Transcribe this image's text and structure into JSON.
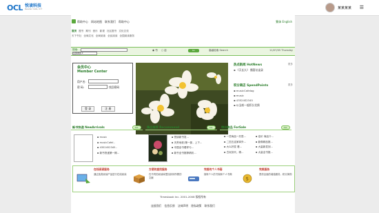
{
  "app": {
    "logo_mark": "OCL",
    "logo_cn": "悦读科技",
    "logo_en": "Reader Cafe, ICT",
    "user_name": "某某某某",
    "menu_icon": "☰"
  },
  "nav": {
    "links": [
      "帮助中心",
      "网站地图",
      "联系我们",
      "帮助中心"
    ],
    "lang": "繁体 English"
  },
  "subnav": {
    "row1": [
      "首页",
      "图书",
      "期刊",
      "音乐",
      "影视",
      "社区图书",
      "文化交流"
    ],
    "row2": [
      "天下书社",
      "全局文化",
      "全局阅读",
      "全民阅读",
      "全国阅读服务"
    ]
  },
  "search": {
    "label": "搜索:",
    "select": "全部类别 ▾",
    "radio1": "书",
    "radio2": "店",
    "button": "Go",
    "advanced": "高级检索 Search",
    "date": "11/07/05 Thursday"
  },
  "member": {
    "title": "会员中心",
    "title_en": "Member Center",
    "user_label": "用户名:",
    "pass_label": "密 码:",
    "forgot": "找回密码",
    "login": "登 录",
    "register": "注 册"
  },
  "hot": {
    "title": "热点新闻 HotNews",
    "more": "更多",
    "items": [
      "《天长久》",
      "播客访谈录"
    ]
  },
  "spend": {
    "title": "积分商店 SpendPoints",
    "more": "更多",
    "items": [
      "musicCafeIog",
      "music",
      "43524S2345",
      "以当前一般积分兑换"
    ]
  },
  "arrivals": {
    "title": "新书快递 NewArrivals",
    "all": "ALL",
    "items": [
      "music",
      "musicCafeI..",
      "4352452345..",
      "新书快递第一期..."
    ]
  },
  "recommend": {
    "title": "精品推荐 Recommend",
    "all": "ALL",
    "items": [
      "悦读新书发...",
      "天荒地老(第一部，上下...",
      "中国全书看样与...",
      "新书全书推荐精彩..."
    ]
  },
  "forsale": {
    "title": "特价商品 ForSale",
    "all": "ALL",
    "items": [
      "一些商品一共售...",
      "二四五这家拿外...",
      "大么好发 看...",
      "古玩刻代，精..."
    ],
    "items2": [
      "定价 商品介...",
      "影像精品推...",
      "大量新发到...",
      "大量全书推..."
    ]
  },
  "features": [
    {
      "title": "在线阅读服务",
      "desc": "通过各类阅读产品进行在线阅读"
    },
    {
      "title": "方便的查找服务",
      "desc": "在不同的阅读库里找到你所需的文献"
    },
    {
      "title": "完善的个人书斋",
      "desc": "拥有个人的书架和个人书斋"
    },
    {
      "title": "完美服务",
      "desc": "提供全面的增值服务，积分换购"
    }
  ],
  "footer": {
    "copyright": "Timesbook Inc. 2001-2008 版权所有",
    "links": "连接我们 信息反馈 法律声明 隐私政策 联系我们"
  },
  "colors": {
    "accent": "#2a7d2a",
    "border": "#7bbf5a",
    "brand": "#1a73c8"
  }
}
